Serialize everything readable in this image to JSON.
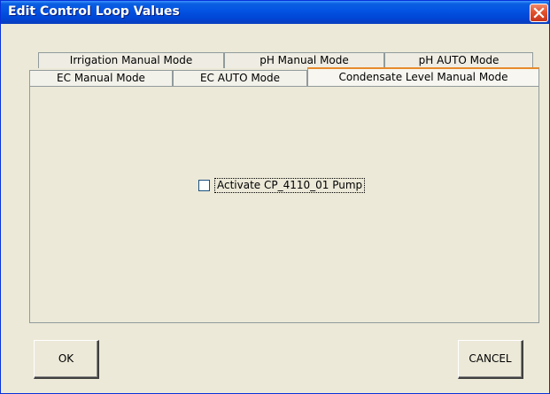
{
  "window": {
    "title": "Edit Control Loop Values",
    "close_icon": "close-icon"
  },
  "tabs": {
    "row_back": [
      {
        "label": "Irrigation Manual Mode"
      },
      {
        "label": "pH Manual Mode"
      },
      {
        "label": "pH AUTO Mode"
      }
    ],
    "row_front": [
      {
        "label": "EC Manual Mode"
      },
      {
        "label": "EC AUTO Mode"
      },
      {
        "label": "Condensate Level Manual Mode",
        "active": true
      }
    ]
  },
  "panel": {
    "checkbox_label": "Activate CP_4110_01 Pump",
    "checkbox_checked": false
  },
  "buttons": {
    "ok": "OK",
    "cancel": "CANCEL"
  },
  "colors": {
    "titlebar": "#0554e3",
    "face": "#ece9d8",
    "close": "#e2522e"
  }
}
